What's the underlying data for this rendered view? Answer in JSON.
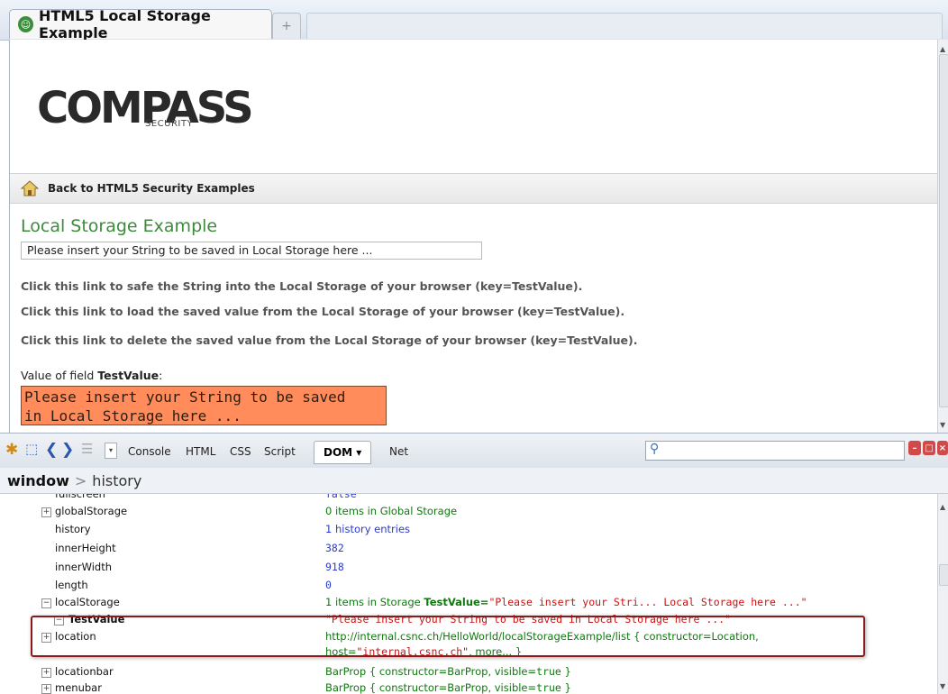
{
  "tab": {
    "title": "HTML5 Local Storage Example",
    "newtab_glyph": "+"
  },
  "page": {
    "logo_text": "COMPASS",
    "logo_sub": "SECURITY",
    "back_link": "Back to HTML5 Security Examples",
    "heading": "Local Storage Example",
    "input_value": "Please insert your String to be saved in Local Storage here ...",
    "link_save": "Click this link to safe the String into the Local Storage of your browser (key=TestValue).",
    "link_load": "Click this link to load the saved value from the Local Storage of your browser (key=TestValue).",
    "link_delete": "Click this link to delete the saved value from the Local Storage of your browser (key=TestValue).",
    "value_label_prefix": "Value of field ",
    "value_label_key": "TestValue",
    "value_label_suffix": ":",
    "value_line1": "Please insert your String to be saved",
    "value_line2": "in Local Storage here ...",
    "value_box_color": "#ff8c5a"
  },
  "firebug": {
    "tabs": [
      "Console",
      "HTML",
      "CSS",
      "Script",
      "DOM ▾",
      "Net"
    ],
    "active_tab": "DOM ▾",
    "search_placeholder": ""
  },
  "breadcrumb": {
    "root": "window",
    "separator": ">",
    "current": "history"
  },
  "dom_rows": [
    {
      "name": "fullscreen",
      "value": "false"
    },
    {
      "name": "globalStorage",
      "value": "0 items in Global Storage",
      "expandable": true
    },
    {
      "name": "history",
      "value": "1 history entries"
    },
    {
      "name": "innerHeight",
      "value": "382"
    },
    {
      "name": "innerWidth",
      "value": "918"
    },
    {
      "name": "length",
      "value": "0"
    },
    {
      "name": "localStorage",
      "value_prefix": "1 items in Storage ",
      "value_key": "TestValue=",
      "value_str": "\"Please insert your Stri... Local Storage here ...\"",
      "expandable": true,
      "expanded": true
    },
    {
      "name": "TestValue",
      "value": "\"Please insert your String to be saved in Local Storage here ...\""
    },
    {
      "name": "location",
      "value_line1_url": "http://internal.csnc.ch/HelloWorld/localStorageExample/list",
      "value_line1_rest": " { constructor=Location,",
      "value_line2_key": "host=",
      "value_line2_str": "\"internal.csnc.ch\"",
      "value_line2_rest": ",  more... }",
      "expandable": true
    },
    {
      "name": "locationbar",
      "value_prefix": "BarProp { constructor=BarProp,  visible=",
      "value_bool": "true",
      "value_suffix": " }",
      "expandable": true
    },
    {
      "name": "menubar",
      "value_prefix": "BarProp { constructor=BarProp,  visible=",
      "value_bool": "true",
      "value_suffix": " }",
      "expandable": true
    }
  ],
  "colors": {
    "heading_green": "#3d8a3d",
    "highlight_border": "#8b1a1a"
  }
}
